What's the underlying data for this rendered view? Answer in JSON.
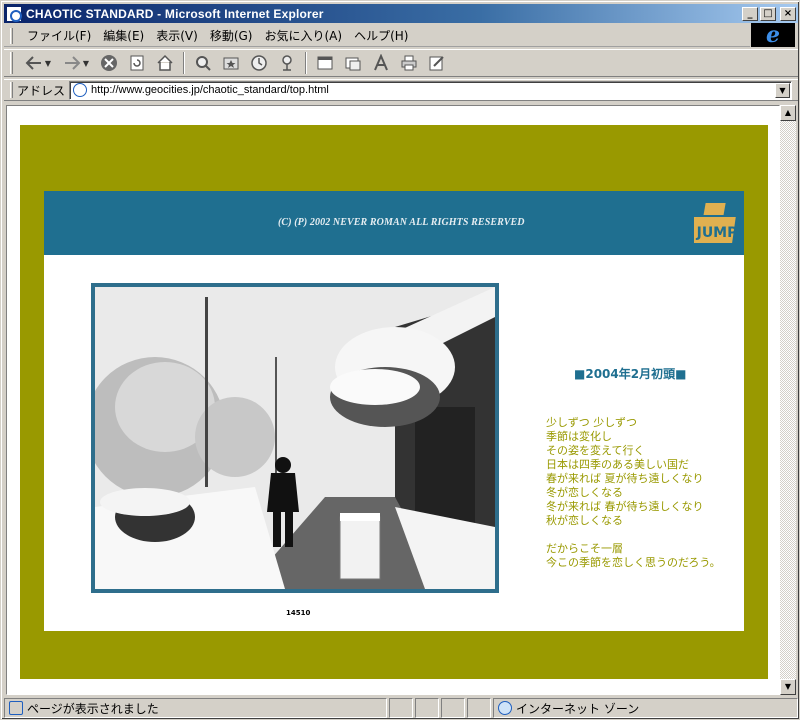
{
  "window": {
    "title": "CHAOTIC STANDARD - Microsoft Internet Explorer",
    "minimize_glyph": "_",
    "maximize_glyph": "□",
    "close_glyph": "×"
  },
  "menu": {
    "items": [
      "ファイル(F)",
      "編集(E)",
      "表示(V)",
      "移動(G)",
      "お気に入り(A)",
      "ヘルプ(H)"
    ]
  },
  "toolbar": {
    "icons": [
      "back-icon",
      "forward-icon",
      "stop-icon",
      "refresh-icon",
      "home-icon",
      "search-icon",
      "favorites-icon",
      "history-icon",
      "channels-icon",
      "fullscreen-icon",
      "mail-icon",
      "font-icon",
      "print-icon",
      "edit-icon"
    ]
  },
  "address": {
    "label": "アドレス",
    "url": "http://www.geocities.jp/chaotic_standard/top.html"
  },
  "page": {
    "copyright": "(C) (P) 2002 NEVER ROMAN ALL RIGHTS RESERVED",
    "logo_text": "JUMP",
    "counter": "14510",
    "date_heading": "■2004年2月初頭■",
    "poem_stanza1": [
      "少しずつ 少しずつ",
      "季節は変化し",
      "その姿を変えて行く",
      "日本は四季のある美しい国だ",
      "春が来れば 夏が待ち遠しくなり",
      "冬が恋しくなる",
      "冬が来れば 春が待ち遠しくなり",
      "秋が恋しくなる"
    ],
    "poem_stanza2": [
      "だからこそ一層",
      "今この季節を恋しく思うのだろう。"
    ],
    "colors": {
      "olive": "#999900",
      "banner": "#1f6f90",
      "logo": "#e0b050"
    }
  },
  "status": {
    "message": "ページが表示されました",
    "zone": "インターネット ゾーン"
  }
}
